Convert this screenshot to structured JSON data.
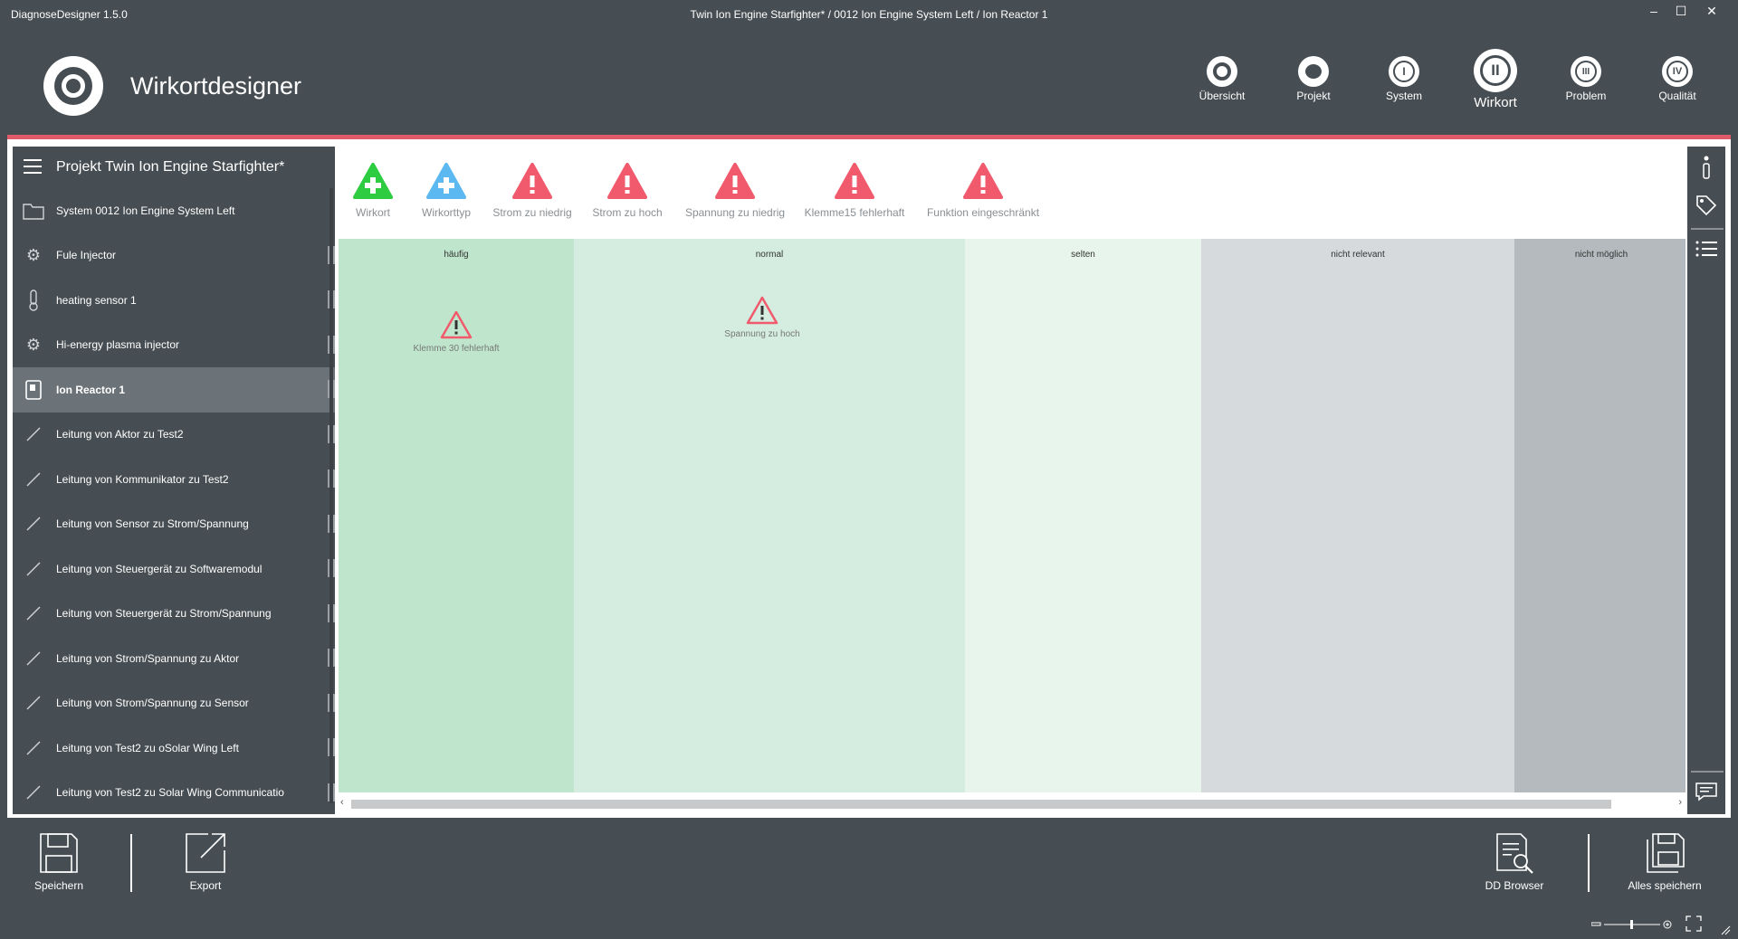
{
  "window": {
    "app_name": "DiagnoseDesigner 1.5.0",
    "title": "Twin Ion Engine Starfighter* / 0012 Ion Engine System Left / Ion Reactor 1",
    "controls": {
      "minimize": "–",
      "maximize": "☐",
      "close": "✕"
    }
  },
  "header": {
    "title": "Wirkortdesigner",
    "nav": [
      {
        "label": "Übersicht",
        "icon": "circle-o-icon",
        "glyph": ""
      },
      {
        "label": "Projekt",
        "icon": "circle-drop-icon",
        "glyph": ""
      },
      {
        "label": "System",
        "icon": "roman-one-icon",
        "glyph": "I"
      },
      {
        "label": "Wirkort",
        "icon": "roman-two-icon",
        "glyph": "II",
        "active": true
      },
      {
        "label": "Problem",
        "icon": "roman-three-icon",
        "glyph": "III"
      },
      {
        "label": "Qualität",
        "icon": "roman-four-icon",
        "glyph": "IV"
      }
    ],
    "accent_color": "#e05a6a"
  },
  "sidebar": {
    "title": "Projekt Twin Ion Engine Starfighter*",
    "items": [
      {
        "label": "System 0012 Ion Engine System Left",
        "icon": "folder-icon"
      },
      {
        "label": "Fule Injector",
        "icon": "gear-icon"
      },
      {
        "label": "heating sensor 1",
        "icon": "thermometer-icon"
      },
      {
        "label": "Hi-energy plasma injector",
        "icon": "gear-icon"
      },
      {
        "label": "Ion Reactor 1",
        "icon": "document-icon",
        "selected": true
      },
      {
        "label": "Leitung von Aktor zu Test2",
        "icon": "line-icon"
      },
      {
        "label": "Leitung von Kommunikator zu Test2",
        "icon": "line-icon"
      },
      {
        "label": "Leitung von Sensor zu Strom/Spannung",
        "icon": "line-icon"
      },
      {
        "label": "Leitung von Steuergerät zu Softwaremodul",
        "icon": "line-icon"
      },
      {
        "label": "Leitung von Steuergerät zu Strom/Spannung",
        "icon": "line-icon"
      },
      {
        "label": "Leitung von Strom/Spannung zu Aktor",
        "icon": "line-icon"
      },
      {
        "label": "Leitung von Strom/Spannung zu Sensor",
        "icon": "line-icon"
      },
      {
        "label": "Leitung von Test2  zu oSolar Wing Left",
        "icon": "line-icon"
      },
      {
        "label": "Leitung von Test2  zu Solar Wing Communicatio",
        "icon": "line-icon"
      }
    ]
  },
  "toolbar": {
    "tools": [
      {
        "label": "Wirkort",
        "icon": "add-green-icon",
        "color": "#2ecc40"
      },
      {
        "label": "Wirkorttyp",
        "icon": "add-blue-icon",
        "color": "#5bb8f0"
      },
      {
        "label": "Strom zu niedrig",
        "icon": "warning-icon",
        "color": "#f15a6c"
      },
      {
        "label": "Strom zu hoch",
        "icon": "warning-icon",
        "color": "#f15a6c"
      },
      {
        "label": "Spannung zu niedrig",
        "icon": "warning-icon",
        "color": "#f15a6c"
      },
      {
        "label": "Klemme15 fehlerhaft",
        "icon": "warning-icon",
        "color": "#f15a6c"
      },
      {
        "label": "Funktion eingeschränkt",
        "icon": "warning-icon",
        "color": "#f15a6c"
      }
    ]
  },
  "board": {
    "columns": [
      {
        "header": "häufig",
        "color": "#bfe6cc"
      },
      {
        "header": "normal",
        "color": "#d4ede0"
      },
      {
        "header": "selten",
        "color": "#e8f5ec"
      },
      {
        "header": "nicht relevant",
        "color": "#d6dadc"
      },
      {
        "header": "nicht möglich",
        "color": "#b4babd"
      }
    ],
    "cards": [
      {
        "label": "Klemme 30 fehlerhaft",
        "column": "häufig",
        "icon": "warning-outline-icon"
      },
      {
        "label": "Spannung zu hoch",
        "column": "normal",
        "icon": "warning-outline-icon"
      }
    ]
  },
  "bottom": {
    "save": "Speichern",
    "export": "Export",
    "dd_browser": "DD Browser",
    "save_all": "Alles speichern"
  }
}
